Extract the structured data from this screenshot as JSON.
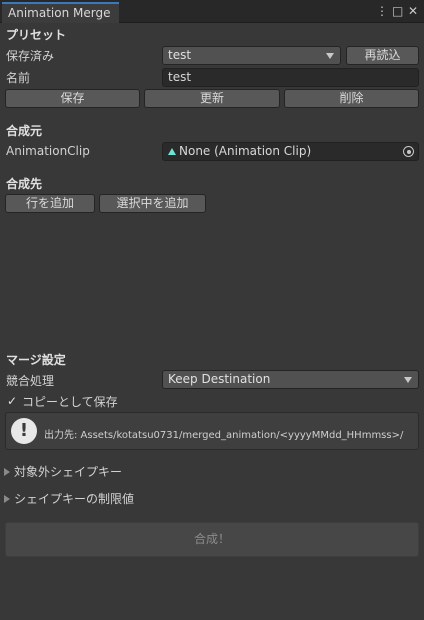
{
  "window": {
    "tab_title": "Animation Merge",
    "icons": [
      "more-vert-icon",
      "maximize-icon",
      "close-icon"
    ],
    "accent": "#3a79bb"
  },
  "preset": {
    "header": "プリセット",
    "saved_label": "保存済み",
    "saved_value": "test",
    "reload_label": "再読込",
    "name_label": "名前",
    "name_value": "test",
    "save_label": "保存",
    "update_label": "更新",
    "delete_label": "削除"
  },
  "source": {
    "header": "合成元",
    "clip_label": "AnimationClip",
    "clip_value": "None (Animation Clip)"
  },
  "dest": {
    "header": "合成先",
    "add_row_label": "行を追加",
    "add_selected_label": "選択中を追加"
  },
  "merge": {
    "header": "マージ設定",
    "conflict_label": "競合処理",
    "conflict_value": "Keep Destination",
    "save_as_copy_label": "コピーとして保存",
    "save_as_copy_checked": true,
    "output_text": "出力先: Assets/kotatsu0731/merged_animation/<yyyyMMdd_HHmmss>/"
  },
  "foldouts": {
    "excluded_label": "対象外シェイプキー",
    "limits_label": "シェイプキーの制限値"
  },
  "action": {
    "merge_label": "合成！"
  }
}
